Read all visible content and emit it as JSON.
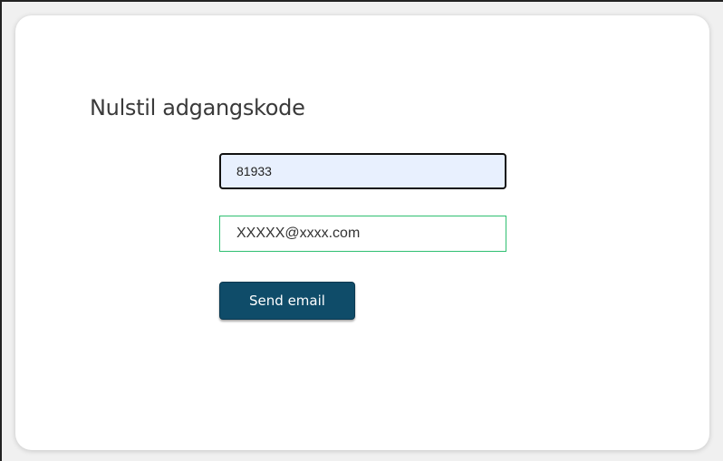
{
  "form": {
    "title": "Nulstil adgangskode",
    "code_value": "81933",
    "email_placeholder": "XXXXX@xxxx.com",
    "send_label": "Send email"
  },
  "colors": {
    "button_bg": "#0f4c69",
    "email_border": "#2fbf71",
    "code_field_bg": "#e8f0fe"
  }
}
